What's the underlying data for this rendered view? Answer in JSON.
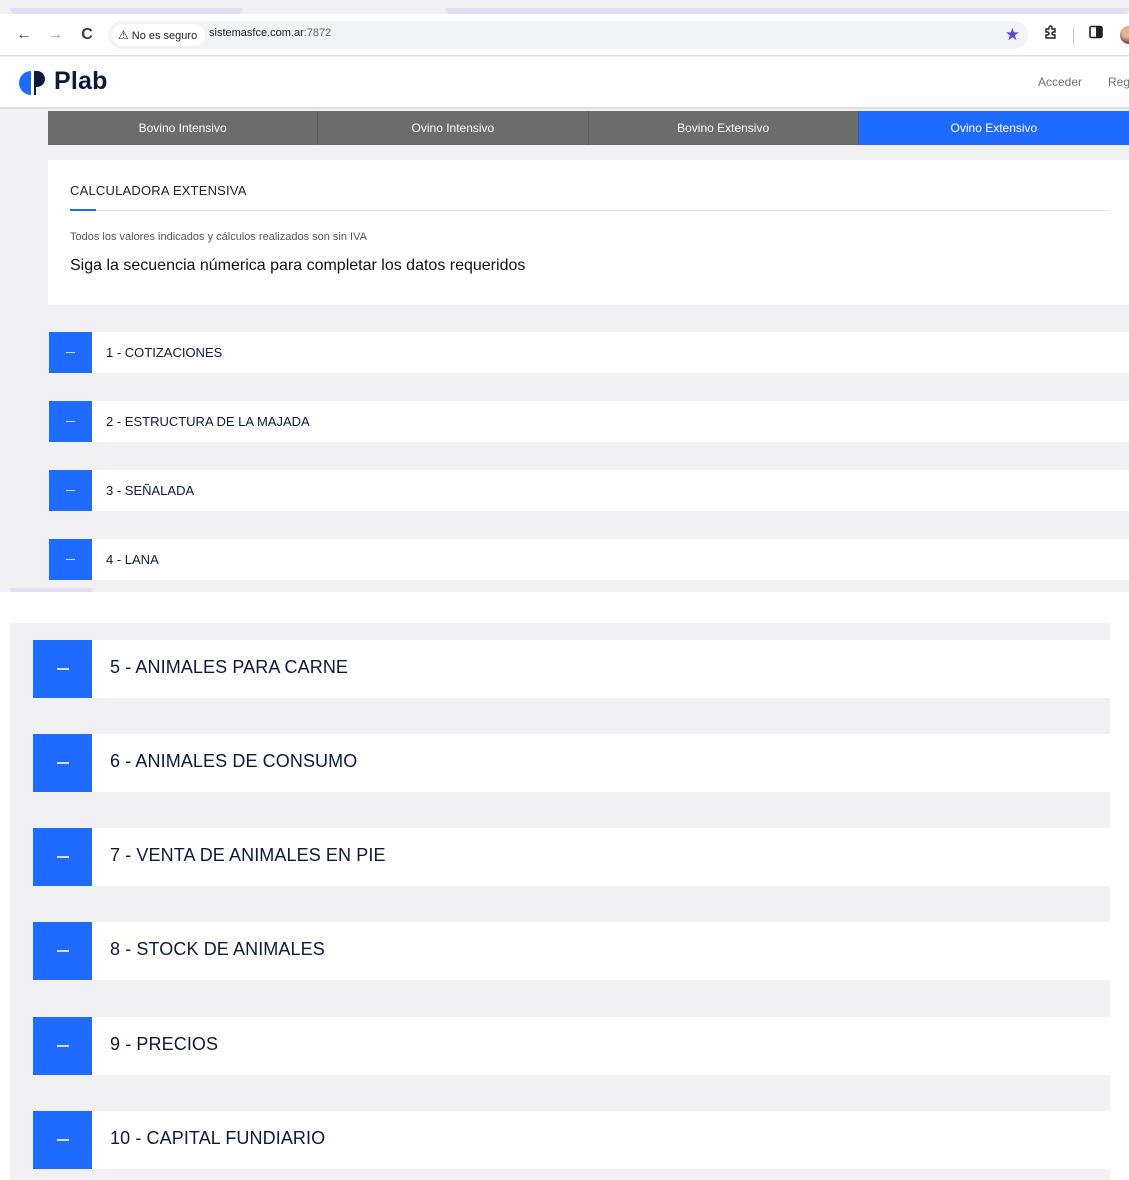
{
  "browser": {
    "security_label": "No es seguro",
    "url_host": "sistemasfce.com.ar",
    "url_port": ":7872"
  },
  "site": {
    "brand": "Plab",
    "login_link": "Acceder",
    "register_link": "Reg"
  },
  "calc_tabs": [
    {
      "label": "Bovino Intensivo"
    },
    {
      "label": "Ovino Intensivo"
    },
    {
      "label": "Bovino Extensivo"
    },
    {
      "label": "Ovino Extensivo",
      "active": true
    }
  ],
  "card": {
    "title": "CALCULADORA EXTENSIVA",
    "note": "Todos los valores indicados y cálculos realizados son sin IVA",
    "lead": "Siga la secuencia númerica para completar los datos requeridos"
  },
  "sections_top": [
    {
      "label": "1 - COTIZACIONES"
    },
    {
      "label": "2 - ESTRUCTURA DE LA MAJADA"
    },
    {
      "label": "3 - SEÑALADA"
    },
    {
      "label": "4 - LANA"
    }
  ],
  "sections_bottom": [
    {
      "label": "5 - ANIMALES PARA CARNE"
    },
    {
      "label": "6 - ANIMALES DE CONSUMO"
    },
    {
      "label": "7 - VENTA DE ANIMALES EN PIE"
    },
    {
      "label": "8 - STOCK DE ANIMALES"
    },
    {
      "label": "9 - PRECIOS"
    },
    {
      "label": "10 - CAPITAL FUNDIARIO"
    }
  ],
  "colors": {
    "accent": "#1f6bff",
    "tab_inactive": "#6c6c6c",
    "page_bg": "#f1f1f3",
    "text_dark": "#0b1a3a"
  },
  "icons": {
    "back": "arrow-left-icon",
    "forward": "arrow-right-icon",
    "reload": "reload-icon",
    "warning": "warning-triangle-icon",
    "bookmark": "star-icon",
    "extensions": "puzzle-icon",
    "side_panel": "side-panel-icon",
    "collapse": "minus-icon"
  }
}
